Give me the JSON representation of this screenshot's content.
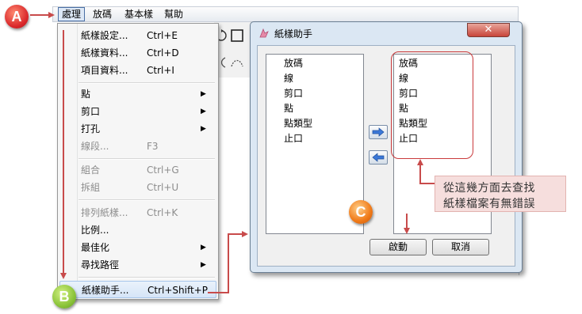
{
  "menubar": {
    "items": [
      "處理",
      "放碼",
      "基本樣",
      "幫助"
    ]
  },
  "menu": {
    "items": [
      {
        "label": "紙樣設定...",
        "shortcut": "Ctrl+E",
        "submenu": false,
        "disabled": false
      },
      {
        "label": "紙樣資料...",
        "shortcut": "Ctrl+D",
        "submenu": false,
        "disabled": false
      },
      {
        "label": "項目資料...",
        "shortcut": "Ctrl+I",
        "submenu": false,
        "disabled": false
      },
      {
        "label": "點",
        "shortcut": "",
        "submenu": true,
        "disabled": false
      },
      {
        "label": "剪口",
        "shortcut": "",
        "submenu": true,
        "disabled": false
      },
      {
        "label": "打孔",
        "shortcut": "",
        "submenu": true,
        "disabled": false
      },
      {
        "label": "線段...",
        "shortcut": "F3",
        "submenu": false,
        "disabled": true
      },
      {
        "label": "組合",
        "shortcut": "Ctrl+G",
        "submenu": false,
        "disabled": true
      },
      {
        "label": "拆組",
        "shortcut": "Ctrl+U",
        "submenu": false,
        "disabled": true
      },
      {
        "label": "排列紙樣...",
        "shortcut": "Ctrl+K",
        "submenu": false,
        "disabled": true
      },
      {
        "label": "比例...",
        "shortcut": "",
        "submenu": false,
        "disabled": false
      },
      {
        "label": "最佳化",
        "shortcut": "",
        "submenu": true,
        "disabled": false
      },
      {
        "label": "尋找路徑",
        "shortcut": "",
        "submenu": true,
        "disabled": false
      },
      {
        "label": "紙樣助手...",
        "shortcut": "Ctrl+Shift+P",
        "submenu": false,
        "disabled": false
      }
    ]
  },
  "dialog": {
    "title": "紙樣助手",
    "close_symbol": "✕",
    "left_list": [
      "放碼",
      "線",
      "剪口",
      "點",
      "點類型",
      "止口"
    ],
    "right_list": [
      "放碼",
      "線",
      "剪口",
      "點",
      "點類型",
      "止口"
    ],
    "start_label": "啟動",
    "cancel_label": "取消"
  },
  "annotations": {
    "badge_a": "A",
    "badge_b": "B",
    "badge_c": "C",
    "callout_line1": "從這幾方面去查找",
    "callout_line2": "紙樣檔案有無錯誤"
  },
  "colors": {
    "annotation_arrow": "#c84b4b",
    "badge_a": "#d9262a",
    "badge_b": "#8cc43a",
    "badge_c": "#f07a18",
    "callout_bg": "#f6dedd"
  }
}
